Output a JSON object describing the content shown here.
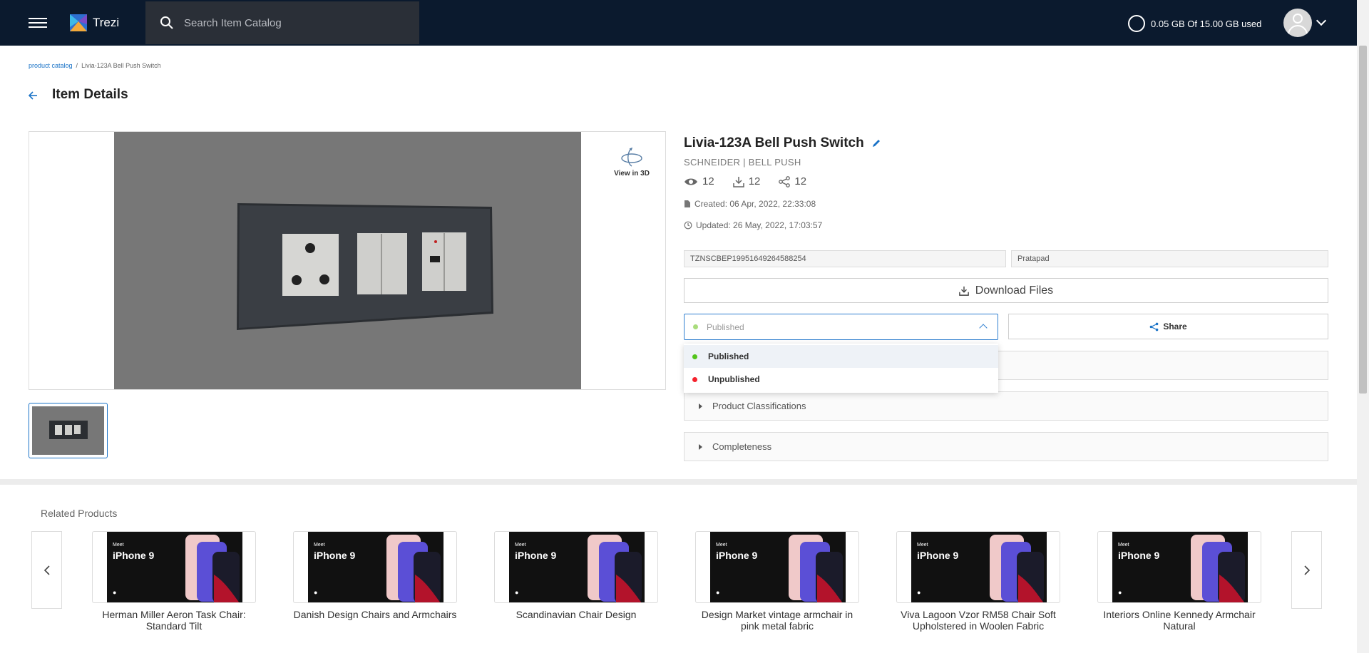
{
  "app": {
    "name": "Trezi"
  },
  "search": {
    "placeholder": "Search Item Catalog"
  },
  "storage": {
    "text": "0.05 GB Of 15.00 GB used"
  },
  "breadcrumb": {
    "root": "product catalog",
    "separator": "/",
    "current": "Livia-123A Bell Push Switch"
  },
  "page": {
    "title": "Item Details"
  },
  "viewer": {
    "view3d_label": "View in 3D"
  },
  "item": {
    "name": "Livia-123A Bell Push Switch",
    "brand": "SCHNEIDER | BELL PUSH",
    "views": "12",
    "downloads": "12",
    "shares": "12",
    "created": "Created: 06 Apr, 2022, 22:33:08",
    "updated": "Updated: 26 May, 2022, 17:03:57",
    "sku": "TZNSCBEP19951649264588254",
    "owner": "Pratapad"
  },
  "actions": {
    "download": "Download Files",
    "share": "Share"
  },
  "status": {
    "selected": "Published",
    "options": [
      {
        "label": "Published",
        "color": "#52c41a"
      },
      {
        "label": "Unpublished",
        "color": "#f5222d"
      }
    ]
  },
  "accordions": [
    "Product Classifications",
    "Completeness"
  ],
  "related": {
    "title": "Related Products",
    "promo": {
      "meet": "Meet",
      "model": "iPhone 9",
      "logo": ""
    },
    "items": [
      "Herman Miller Aeron Task Chair: Standard Tilt",
      "Danish Design Chairs and Armchairs",
      "Scandinavian Chair Design",
      "Design Market vintage armchair in pink metal fabric",
      "Viva Lagoon Vzor RM58 Chair Soft Upholstered in Woolen Fabric",
      "Interiors Online Kennedy Armchair Natural"
    ]
  },
  "colors": {
    "topbar": "#0b1a2e",
    "accent": "#1a73c7"
  }
}
